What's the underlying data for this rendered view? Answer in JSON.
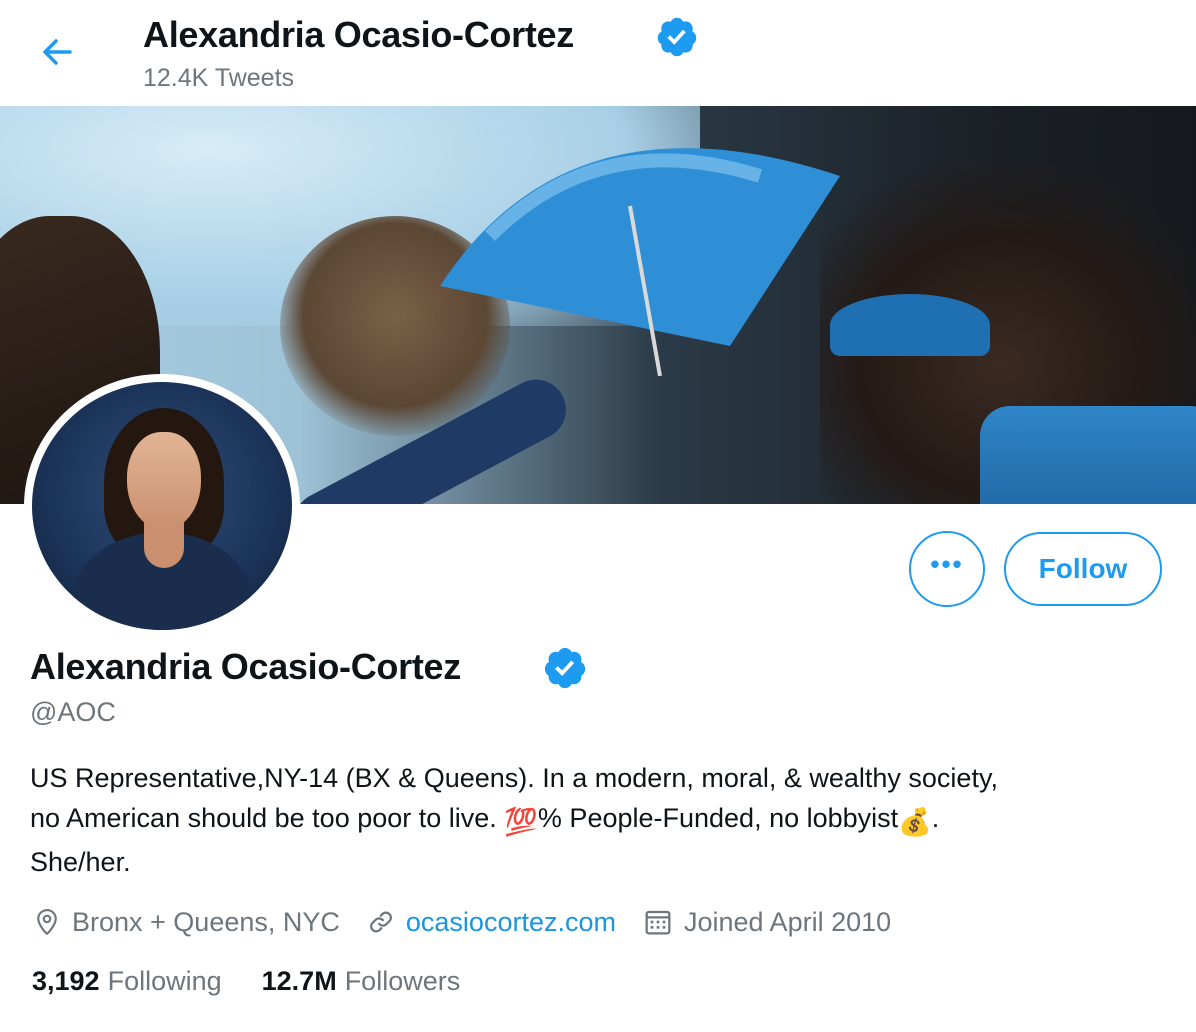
{
  "header": {
    "name": "Alexandria Ocasio-Cortez",
    "tweet_count": "12.4K Tweets"
  },
  "profile": {
    "name": "Alexandria Ocasio-Cortez",
    "handle": "@AOC",
    "bio_line1": "US Representative,NY-14 (BX & Queens). In a modern, moral, & wealthy society,",
    "bio_line2_a": "no American should be too poor to live. ",
    "bio_emoji_100": "💯",
    "bio_line2_b": "% People-Funded, no lobbyist",
    "bio_emoji_money": "💰",
    "bio_line2_c": ".",
    "bio_line3": "She/her.",
    "location": "Bronx + Queens, NYC",
    "website": "ocasiocortez.com",
    "joined": "Joined April 2010",
    "following_count": "3,192",
    "following_label": "Following",
    "followers_count": "12.7M",
    "followers_label": "Followers"
  },
  "actions": {
    "more_label": "•••",
    "follow_label": "Follow"
  },
  "colors": {
    "accent": "#1d9bf0",
    "verified": "#1d9bf0",
    "secondary_text": "#6e767d"
  },
  "icons": {
    "back": "arrow-left-icon",
    "verified": "verified-badge-icon",
    "location": "location-pin-icon",
    "link": "link-icon",
    "calendar": "calendar-icon"
  }
}
